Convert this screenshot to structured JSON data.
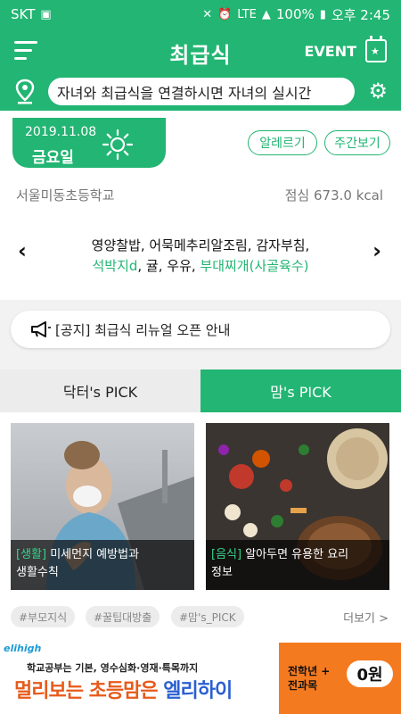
{
  "status_bar": {
    "carrier": "SKT",
    "battery": "100%",
    "time": "오후 2:45",
    "network": "LTE"
  },
  "header": {
    "title": "최급식",
    "event_label": "EVENT"
  },
  "ticker": {
    "text": "자녀와 최급식을 연결하시면 자녀의 실시간"
  },
  "meal_card": {
    "date": "2019.11.08",
    "weekday": "금요일",
    "weather_icon": "sun-icon",
    "allergy_button": "알레르기",
    "weekly_button": "주간보기",
    "school_name": "서울미동초등학교",
    "meal_info": "점심 673.0 kcal",
    "menu_line1": "영양찰밥, 어묵메추리알조림, 감자부침,",
    "menu_line2_green_1": "석박지d",
    "menu_line2_plain": ", 귤, 우유, ",
    "menu_line2_green_2": "부대찌개(사골육수)"
  },
  "notice": {
    "text": "[공지] 최급식 리뉴얼 오픈 안내"
  },
  "pick": {
    "tabs": [
      "닥터's PICK",
      "맘's PICK"
    ],
    "active_tab": 1,
    "cards": [
      {
        "category": "[생활]",
        "title_line1": " 미세먼지 예방법과",
        "title_line2": "생활수칙"
      },
      {
        "category": "[음식]",
        "title_line1": " 알아두면 유용한 요리",
        "title_line2": "정보"
      }
    ],
    "tags": [
      "#부모지식",
      "#꿀팁대방출",
      "#맘's_PICK"
    ],
    "more": "더보기 >"
  },
  "ad": {
    "brand": "elihigh",
    "small_text": "학교공부는 기본, 영수심화·영재·특목까지",
    "big_text_1": "멀리보는 초등맘은 ",
    "big_text_2": "엘리하이",
    "cta_text_1": "전학년",
    "cta_text_2": "전과목",
    "cta_price": "0원"
  },
  "colors": {
    "primary": "#22b573",
    "ad_orange": "#f47a20"
  }
}
